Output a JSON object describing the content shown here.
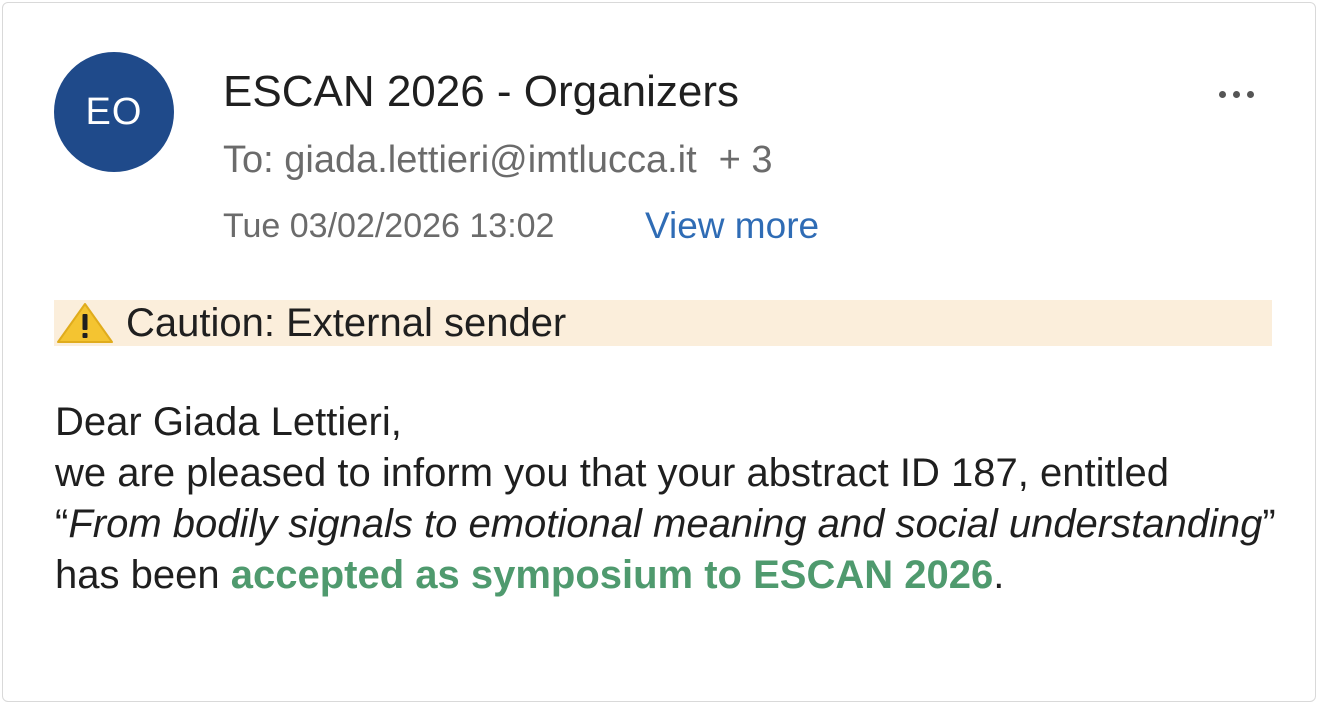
{
  "header": {
    "avatar_initials": "EO",
    "avatar_color": "#1f4a8a",
    "sender_name": "ESCAN 2026 - Organizers",
    "recipient_line": "To: giada.lettieri@imtlucca.it",
    "recipient_extra": "+ 3",
    "date": "Tue 03/02/2026 13:02",
    "view_more_label": "View more",
    "more_menu_icon": "more-horizontal-icon"
  },
  "banner": {
    "icon": "warning-triangle-icon",
    "text": "Caution: External sender",
    "background_color": "#fbeedb",
    "icon_color": "#f4c431"
  },
  "message": {
    "greeting": "Dear Giada Lettieri,",
    "intro": "we are pleased to inform you that your abstract ID 187, entitled",
    "open_quote": "“",
    "abstract_title": "From bodily signals to emotional meaning and social understanding",
    "close_quote_text": "” has been ",
    "accepted_text": "accepted as symposium to ESCAN 2026",
    "accepted_color": "#4f9a6e",
    "end_period": "."
  }
}
